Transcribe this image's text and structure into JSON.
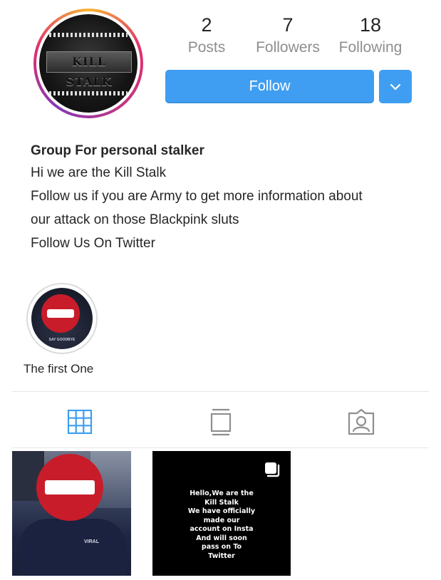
{
  "profile": {
    "avatar_text": "KILL STALK",
    "stats": {
      "posts": {
        "value": "2",
        "label": "Posts"
      },
      "followers": {
        "value": "7",
        "label": "Followers"
      },
      "following": {
        "value": "18",
        "label": "Following"
      }
    },
    "follow_label": "Follow",
    "dropdown_icon": "chevron-down-icon"
  },
  "bio": {
    "name": "Group For personal stalker",
    "lines": [
      "Hi we are the Kill Stalk",
      "Follow us if you are Army to get more information about",
      "our attack on those Blackpink sluts",
      "Follow Us On Twitter"
    ]
  },
  "highlights": [
    {
      "label": "The first One",
      "icon": "no-entry-sign",
      "caption": "SAY GOODBYE"
    }
  ],
  "tabs": [
    {
      "icon": "grid-icon",
      "active": true
    },
    {
      "icon": "feed-icon",
      "active": false
    },
    {
      "icon": "tagged-icon",
      "active": false
    }
  ],
  "posts": [
    {
      "type": "photo",
      "overlay": "no-entry-sign",
      "shirt_text": "VIRAL"
    },
    {
      "type": "text",
      "multi_icon": "multiple-posts-icon",
      "text": "Hello,We are the\nKill Stalk\nWe have officially\nmade our\naccount on Insta\nAnd will soon\npass on To\nTwitter"
    }
  ],
  "colors": {
    "accent": "#3f9ef1",
    "active_tab": "#3f9ef1",
    "inactive_tab": "#8e8e8e",
    "stop_sign": "#c81c2a"
  }
}
